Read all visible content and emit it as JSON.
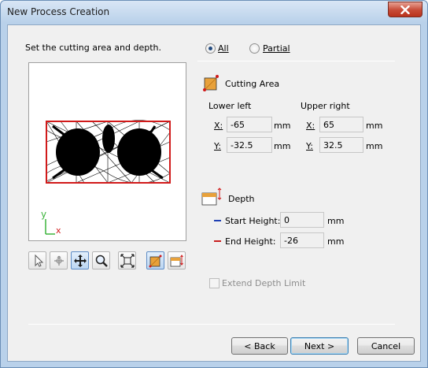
{
  "window": {
    "title": "New Process Creation"
  },
  "instructions": "Set the cutting area and depth.",
  "mode": {
    "all_label": "All",
    "partial_label": "Partial",
    "selected": "All"
  },
  "cutting_area": {
    "heading": "Cutting Area",
    "lower_left_label": "Lower left",
    "upper_right_label": "Upper right",
    "x_label": "X:",
    "y_label": "Y:",
    "lower_left": {
      "x": "-65",
      "y": "-32.5"
    },
    "upper_right": {
      "x": "65",
      "y": "32.5"
    },
    "unit": "mm"
  },
  "depth": {
    "heading": "Depth",
    "start_label": "Start Height:",
    "start_value": "0",
    "end_label": "End Height:",
    "end_value": "-26",
    "unit": "mm",
    "start_color": "#1e3fb4",
    "end_color": "#c81e1e"
  },
  "extend_depth_limit": {
    "label": "Extend Depth Limit",
    "checked": false,
    "enabled": false
  },
  "preview": {
    "axis_y": "y",
    "axis_x": "x",
    "rect_color": "#d11a1a"
  },
  "toolbar": {
    "tools": [
      "select-tool",
      "rotate-tool",
      "pan-tool",
      "zoom-tool",
      "fit-tool",
      "cutting-area-tool",
      "depth-tool"
    ]
  },
  "buttons": {
    "back": "< Back",
    "next": "Next >",
    "cancel": "Cancel"
  }
}
